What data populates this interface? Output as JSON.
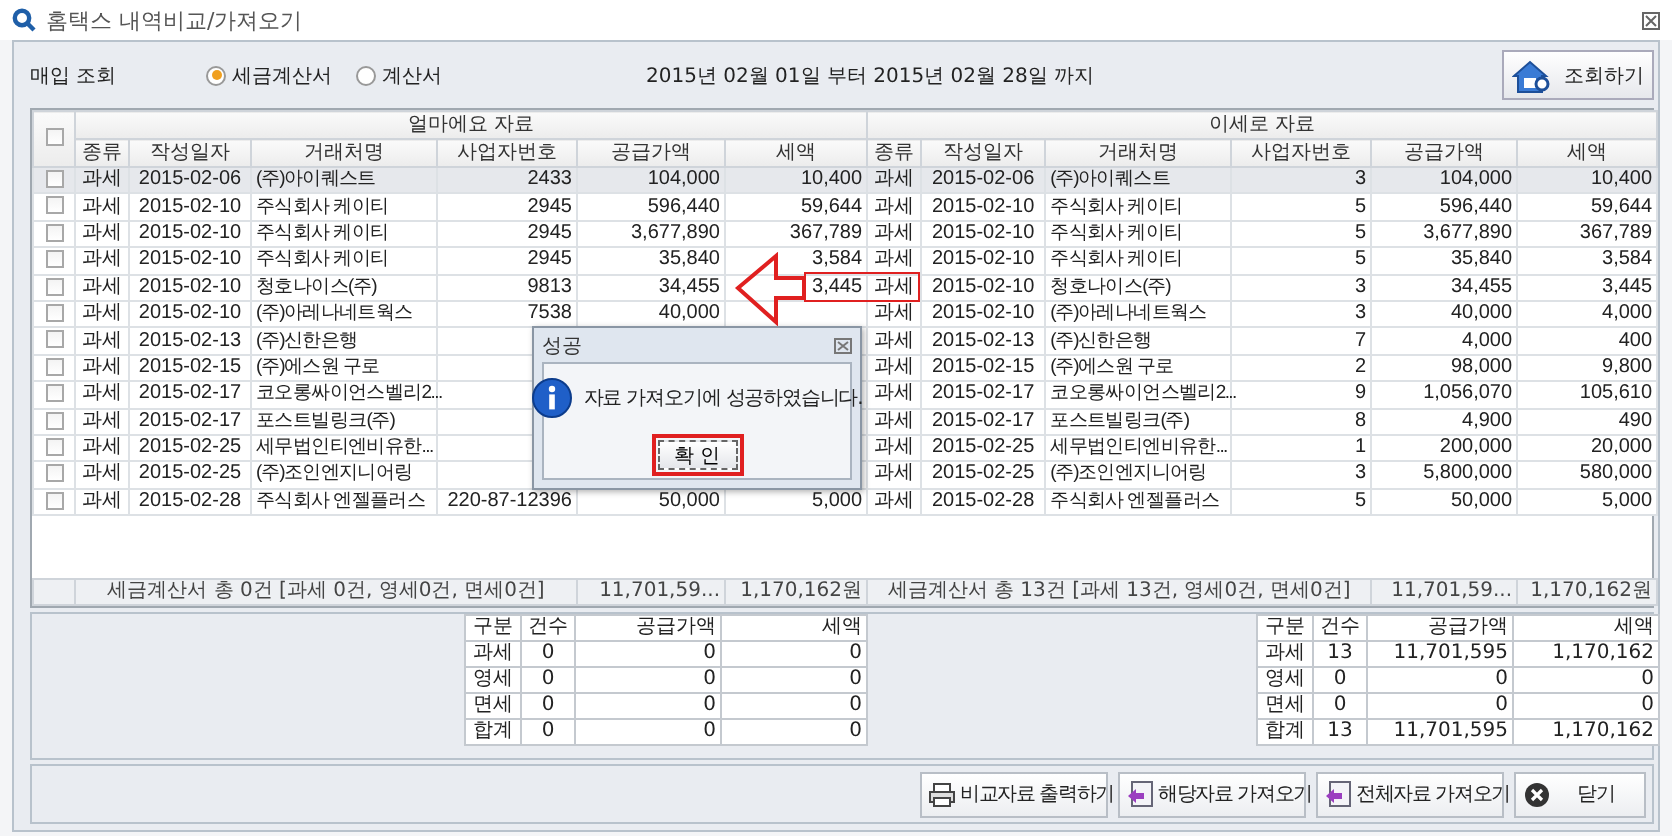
{
  "window": {
    "title": "홈택스 내역비교/가져오기"
  },
  "query": {
    "label": "매입 조회",
    "options": [
      {
        "label": "세금계산서",
        "selected": true
      },
      {
        "label": "계산서",
        "selected": false
      }
    ],
    "period": "2015년 02월 01일 부터 2015년 02월 28일 까지",
    "button": "조회하기"
  },
  "table": {
    "all_checked": false,
    "groups": [
      {
        "title": "얼마에요 자료",
        "columns": [
          "종류",
          "작성일자",
          "거래처명",
          "사업자번호",
          "공급가액",
          "세액"
        ]
      },
      {
        "title": "이세로 자료",
        "columns": [
          "종류",
          "작성일자",
          "거래처명",
          "사업자번호",
          "공급가액",
          "세액"
        ]
      }
    ],
    "rows": [
      {
        "checked": false,
        "selected": true,
        "left": {
          "type": "과세",
          "date": "2015-02-06",
          "name": "(주)아이퀘스트",
          "biz": "2433",
          "supply": "104,000",
          "tax": "10,400"
        },
        "right": {
          "type": "과세",
          "date": "2015-02-06",
          "name": "(주)아이퀘스트",
          "biz": "3",
          "supply": "104,000",
          "tax": "10,400"
        }
      },
      {
        "checked": false,
        "selected": false,
        "left": {
          "type": "과세",
          "date": "2015-02-10",
          "name": "주식회사 케이티",
          "biz": "2945",
          "supply": "596,440",
          "tax": "59,644"
        },
        "right": {
          "type": "과세",
          "date": "2015-02-10",
          "name": "주식회사 케이티",
          "biz": "5",
          "supply": "596,440",
          "tax": "59,644"
        }
      },
      {
        "checked": false,
        "selected": false,
        "left": {
          "type": "과세",
          "date": "2015-02-10",
          "name": "주식회사 케이티",
          "biz": "2945",
          "supply": "3,677,890",
          "tax": "367,789"
        },
        "right": {
          "type": "과세",
          "date": "2015-02-10",
          "name": "주식회사 케이티",
          "biz": "5",
          "supply": "3,677,890",
          "tax": "367,789"
        }
      },
      {
        "checked": false,
        "selected": false,
        "left": {
          "type": "과세",
          "date": "2015-02-10",
          "name": "주식회사 케이티",
          "biz": "2945",
          "supply": "35,840",
          "tax": "3,584"
        },
        "right": {
          "type": "과세",
          "date": "2015-02-10",
          "name": "주식회사 케이티",
          "biz": "5",
          "supply": "35,840",
          "tax": "3,584"
        }
      },
      {
        "checked": false,
        "selected": false,
        "left": {
          "type": "과세",
          "date": "2015-02-10",
          "name": "청호나이스(주)",
          "biz": "9813",
          "supply": "34,455",
          "tax": "3,445"
        },
        "right": {
          "type": "과세",
          "date": "2015-02-10",
          "name": "청호나이스(주)",
          "biz": "3",
          "supply": "34,455",
          "tax": "3,445"
        }
      },
      {
        "checked": false,
        "selected": false,
        "left": {
          "type": "과세",
          "date": "2015-02-10",
          "name": "(주)아레나네트웍스",
          "biz": "7538",
          "supply": "40,000"
        },
        "right": {
          "type": "과세",
          "date": "2015-02-10",
          "name": "(주)아레나네트웍스",
          "biz": "3",
          "supply": "40,000",
          "tax": "4,000"
        }
      },
      {
        "checked": false,
        "selected": false,
        "left": {
          "type": "과세",
          "date": "2015-02-13",
          "name": "(주)신한은행"
        },
        "right": {
          "type": "과세",
          "date": "2015-02-13",
          "name": "(주)신한은행",
          "biz": "7",
          "supply": "4,000",
          "tax": "400"
        }
      },
      {
        "checked": false,
        "selected": false,
        "left": {
          "type": "과세",
          "date": "2015-02-15",
          "name": "(주)에스원 구로"
        },
        "right": {
          "type": "과세",
          "date": "2015-02-15",
          "name": "(주)에스원 구로",
          "biz": "2",
          "supply": "98,000",
          "tax": "9,800"
        }
      },
      {
        "checked": false,
        "selected": false,
        "left": {
          "type": "과세",
          "date": "2015-02-17",
          "name": "코오롱싸이언스벨리2..."
        },
        "right": {
          "type": "과세",
          "date": "2015-02-17",
          "name": "코오롱싸이언스벨리2...",
          "biz": "9",
          "supply": "1,056,070",
          "tax": "105,610"
        }
      },
      {
        "checked": false,
        "selected": false,
        "left": {
          "type": "과세",
          "date": "2015-02-17",
          "name": "포스트빌링크(주)"
        },
        "right": {
          "type": "과세",
          "date": "2015-02-17",
          "name": "포스트빌링크(주)",
          "biz": "8",
          "supply": "4,900",
          "tax": "490"
        }
      },
      {
        "checked": false,
        "selected": false,
        "left": {
          "type": "과세",
          "date": "2015-02-25",
          "name": "세무법인티엔비유한..."
        },
        "right": {
          "type": "과세",
          "date": "2015-02-25",
          "name": "세무법인티엔비유한...",
          "biz": "1",
          "supply": "200,000",
          "tax": "20,000"
        }
      },
      {
        "checked": false,
        "selected": false,
        "left": {
          "type": "과세",
          "date": "2015-02-25",
          "name": "(주)조인엔지니어링"
        },
        "right": {
          "type": "과세",
          "date": "2015-02-25",
          "name": "(주)조인엔지니어링",
          "biz": "3",
          "supply": "5,800,000",
          "tax": "580,000"
        }
      },
      {
        "checked": false,
        "selected": false,
        "left": {
          "type": "과세",
          "date": "2015-02-28",
          "name": "주식회사 엔젤플러스",
          "biz": "220-87-12396",
          "supply": "50,000",
          "tax": "5,000"
        },
        "right": {
          "type": "과세",
          "date": "2015-02-28",
          "name": "주식회사 엔젤플러스",
          "biz": "5",
          "supply": "50,000",
          "tax": "5,000"
        }
      }
    ],
    "footer": [
      {
        "summary": "세금계산서 총 0건 [과세 0건, 영세0건, 면세0건]",
        "supply": "11,701,59...",
        "tax": "1,170,162원"
      },
      {
        "summary": "세금계산서 총 13건 [과세 13건, 영세0건, 면세0건]",
        "supply": "11,701,59...",
        "tax": "1,170,162원"
      }
    ]
  },
  "summaries": [
    {
      "columns": [
        "구분",
        "건수",
        "공급가액",
        "세액"
      ],
      "rows": [
        [
          "과세",
          "0",
          "0",
          "0"
        ],
        [
          "영세",
          "0",
          "0",
          "0"
        ],
        [
          "면세",
          "0",
          "0",
          "0"
        ],
        [
          "합계",
          "0",
          "0",
          "0"
        ]
      ]
    },
    {
      "columns": [
        "구분",
        "건수",
        "공급가액",
        "세액"
      ],
      "rows": [
        [
          "과세",
          "13",
          "11,701,595",
          "1,170,162"
        ],
        [
          "영세",
          "0",
          "0",
          "0"
        ],
        [
          "면세",
          "0",
          "0",
          "0"
        ],
        [
          "합계",
          "13",
          "11,701,595",
          "1,170,162"
        ]
      ]
    }
  ],
  "buttons": [
    {
      "label": "비교자료 출력하기",
      "kind": "print"
    },
    {
      "label": "해당자료 가져오기",
      "kind": "import"
    },
    {
      "label": "전체자료 가져오기",
      "kind": "import"
    },
    {
      "label": "닫기",
      "kind": "close"
    }
  ],
  "dialog": {
    "title": "성공",
    "message": "자료 가져오기에 성공하였습니다.",
    "button": "확 인"
  }
}
